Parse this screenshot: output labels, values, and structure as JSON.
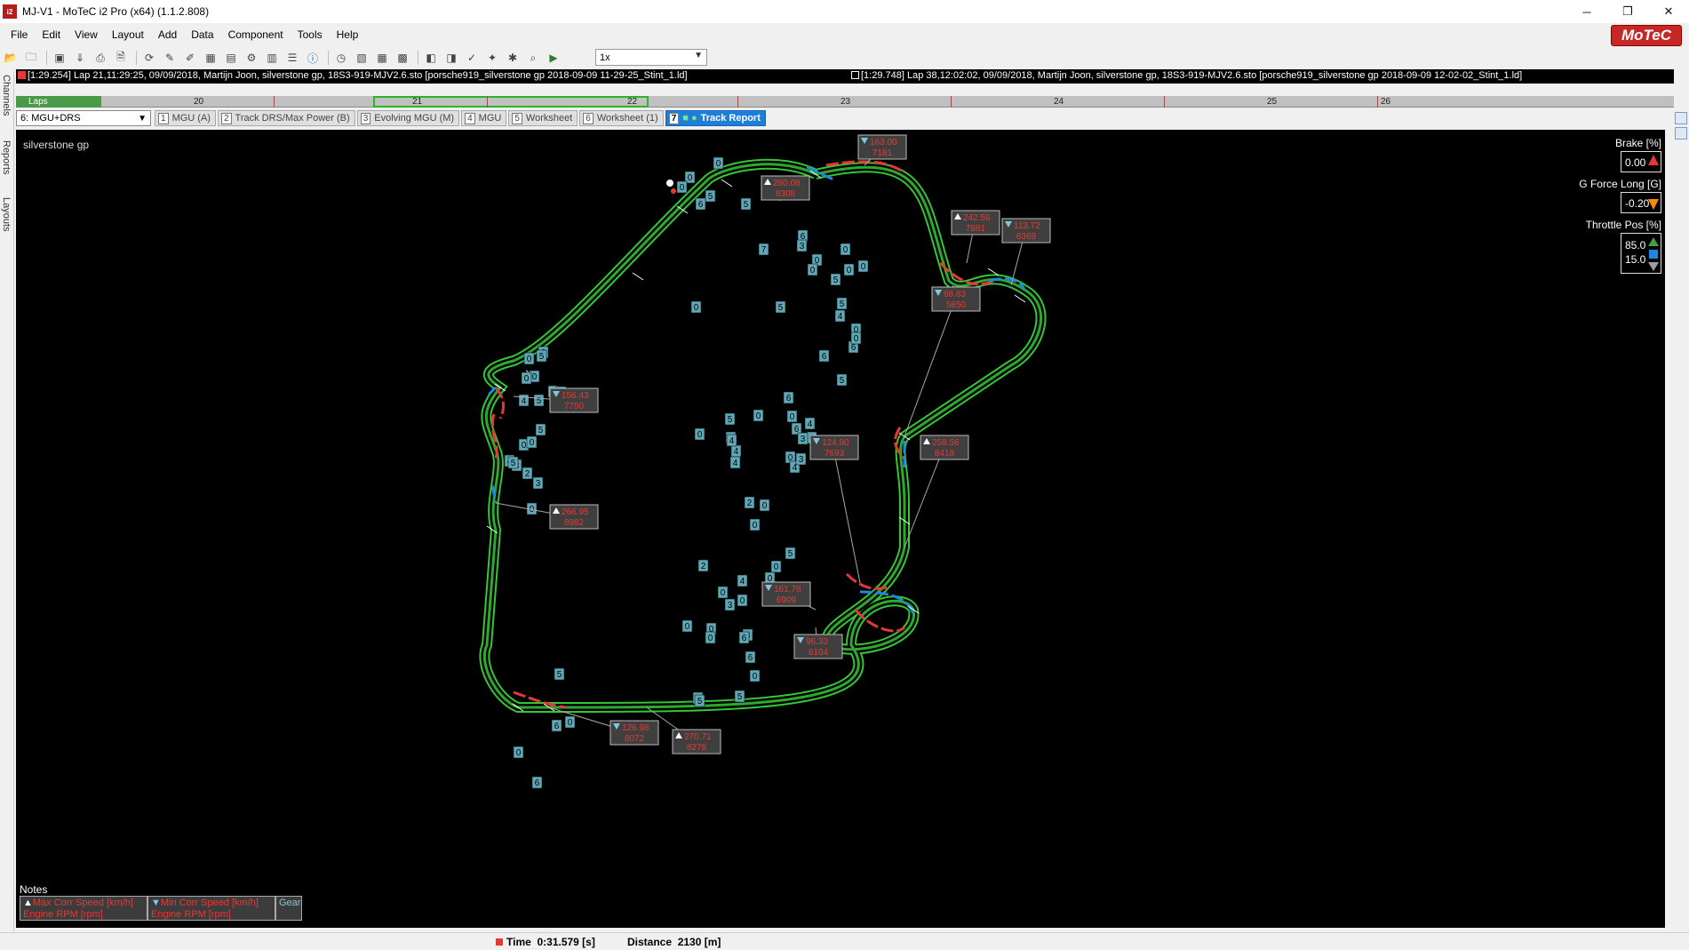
{
  "window": {
    "title": "MJ-V1 - MoTeC i2 Pro (x64) (1.1.2.808)",
    "app_icon": "i2",
    "buttons": [
      "─",
      "❐",
      "✕"
    ]
  },
  "menu": [
    "File",
    "Edit",
    "View",
    "Layout",
    "Add",
    "Data",
    "Component",
    "Tools",
    "Help"
  ],
  "brand": "MoTeC",
  "toolbar": {
    "icons": [
      "open-icon",
      "folder-icon",
      "save-icon",
      "download-icon",
      "print-icon",
      "print-preview-icon",
      "sync-icon",
      "tools-icon",
      "edit-icon",
      "excel-icon",
      "save-alt-icon",
      "filter-icon",
      "table-icon",
      "list-icon",
      "info-icon",
      "clock-icon",
      "overlay-icon",
      "grid-icon",
      "chart-icon",
      "back-icon",
      "forward-icon",
      "marker-icon",
      "map-icon",
      "settings-icon",
      "zoom-icon",
      "play-icon"
    ],
    "playback_speed": "1x"
  },
  "lap_info": {
    "reference": "[1:29.254] Lap 21,11:29:25, 09/09/2018,  Martijn Joon, silverstone gp, 18S3-919-MJV2.6.sto [porsche919_silverstone gp 2018-09-09 11-29-25_Stint_1.ld]",
    "comparison": "[1:29.748] Lap 38,12:02:02, 09/09/2018,  Martijn Joon, silverstone gp, 18S3-919-MJV2.6.sto [porsche919_silverstone gp 2018-09-09 12-02-02_Stint_1.ld]"
  },
  "laps": {
    "label": "Laps",
    "numbers": [
      "20",
      "21",
      "22",
      "23",
      "24",
      "25",
      "26"
    ]
  },
  "sidebar": [
    "Channels",
    "Reports",
    "Layouts"
  ],
  "worksheet_selector": "6: MGU+DRS",
  "tabs": [
    {
      "num": "1",
      "label": "MGU (A)"
    },
    {
      "num": "2",
      "label": "Track DRS/Max Power (B)"
    },
    {
      "num": "3",
      "label": "Evolving MGU (M)"
    },
    {
      "num": "4",
      "label": "MGU"
    },
    {
      "num": "5",
      "label": "Worksheet"
    },
    {
      "num": "6",
      "label": "Worksheet (1)"
    },
    {
      "num": "7",
      "label": "Track Report",
      "active": true
    }
  ],
  "track_name": "silverstone gp",
  "legend": [
    {
      "label": "Brake [%]",
      "values": [
        "0.00"
      ],
      "color": "#e53935"
    },
    {
      "label": "G Force Long [G]",
      "values": [
        "-0.20"
      ],
      "color": "#fb8c00"
    },
    {
      "label": "Throttle Pos [%]",
      "values": [
        "85.0",
        "15.0"
      ],
      "colors": [
        "#43a047",
        "#1e88e5",
        "#9e9e9e"
      ]
    }
  ],
  "callouts": [
    {
      "type": "min",
      "speed": "163.00",
      "rpm": "7181"
    },
    {
      "type": "max",
      "speed": "280.08",
      "rpm": "8308"
    },
    {
      "type": "max",
      "speed": "242.56",
      "rpm": "7881"
    },
    {
      "type": "min",
      "speed": "113.72",
      "rpm": "6369"
    },
    {
      "type": "min",
      "speed": "88.83",
      "rpm": "5850"
    },
    {
      "type": "min",
      "speed": "156.43",
      "rpm": "7750"
    },
    {
      "type": "min",
      "speed": "124.90",
      "rpm": "7693"
    },
    {
      "type": "max",
      "speed": "258.56",
      "rpm": "8418"
    },
    {
      "type": "max",
      "speed": "266.95",
      "rpm": "8982"
    },
    {
      "type": "min",
      "speed": "161.78",
      "rpm": "6909"
    },
    {
      "type": "min",
      "speed": "96.33",
      "rpm": "6104"
    },
    {
      "type": "min",
      "speed": "126.98",
      "rpm": "8072"
    },
    {
      "type": "max",
      "speed": "270.71",
      "rpm": "8278"
    }
  ],
  "gear_labels": [
    "0",
    "0",
    "0",
    "5",
    "6",
    "5",
    "0",
    "0",
    "5",
    "6",
    "7",
    "0",
    "0",
    "4",
    "5",
    "5",
    "0",
    "0",
    "2",
    "3",
    "3",
    "4",
    "0",
    "5",
    "0",
    "6",
    "0",
    "0",
    "5",
    "6",
    "0",
    "6",
    "0",
    "4",
    "3",
    "0",
    "3",
    "4",
    "5",
    "4",
    "4",
    "0",
    "0",
    "3",
    "0",
    "0",
    "5",
    "0",
    "5",
    "4",
    "0",
    "6",
    "0",
    "5",
    "6",
    "0",
    "4",
    "5",
    "0",
    "0",
    "2",
    "0",
    "2",
    "0",
    "0",
    "3",
    "5",
    "0",
    "0",
    "4",
    "3",
    "0",
    "0",
    "0",
    "6",
    "6",
    "0",
    "5",
    "0",
    "5",
    "0",
    "6",
    "6",
    "0",
    "5"
  ],
  "notes": {
    "title": "Notes",
    "boxes": [
      {
        "icon": "max",
        "line1": "Max Corr Speed [km/h]",
        "line2": "Engine RPM [rpm]"
      },
      {
        "icon": "min",
        "line1": "Min Corr Speed [km/h]",
        "line2": "Engine RPM [rpm]"
      },
      {
        "icon": "",
        "line1": "Gear",
        "line2": ""
      }
    ]
  },
  "status": {
    "time_label": "Time",
    "time_value": "0:31.579 [s]",
    "distance_label": "Distance",
    "distance_value": "2130 [m]"
  }
}
